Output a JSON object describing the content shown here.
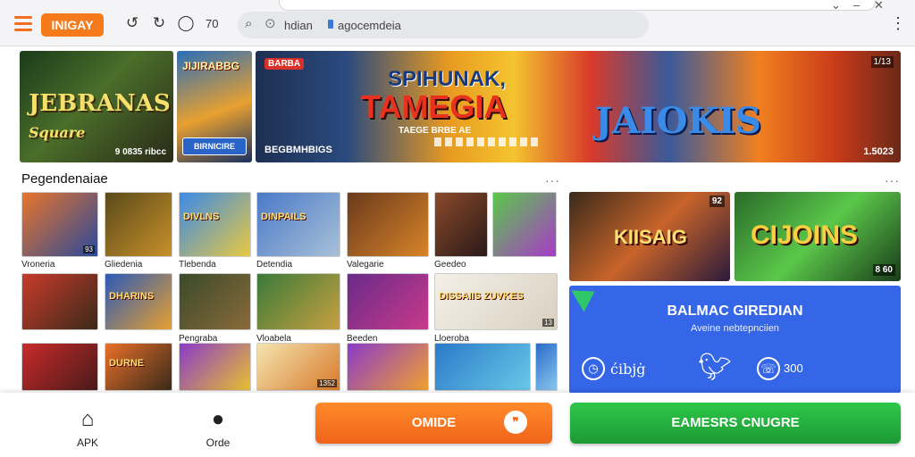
{
  "browser": {
    "logo": "INIGAY",
    "nav_count": "70",
    "address_label": "hdian",
    "url": "agocemdeia"
  },
  "banners": {
    "b1": {
      "title_line1": "JEBRANAS",
      "title_line2": "Square",
      "caption": "9 0835 ribcc"
    },
    "b2": {
      "title": "JIJIRABBG",
      "button": "BIRNICIRE"
    },
    "b3": {
      "tag": "BARBA",
      "left_caption": "BEGBMHBIGS",
      "line1": "SPIHUNAK,",
      "line2": "TAMEGIA",
      "subtitle": "TAEGE BRBE AE",
      "logo_right": "JAIOKIS",
      "page_badge": "1/13",
      "right_caption": "1.5023"
    }
  },
  "section": {
    "title": "Pegendenaiae",
    "more": "···"
  },
  "tiles": [
    {
      "label": "Vroneria",
      "badge": "93",
      "name": "",
      "colors": [
        "#e8742a",
        "#2a4a9a"
      ]
    },
    {
      "label": "Gliedenia",
      "badge": "",
      "name": "",
      "colors": [
        "#5a4a1a",
        "#c8902a"
      ]
    },
    {
      "label": "Tlebenda",
      "badge": "",
      "name": "DIVLNS",
      "colors": [
        "#3a8ae8",
        "#e8c840"
      ]
    },
    {
      "label": "Detendia",
      "badge": "",
      "name": "DINPAILS",
      "colors": [
        "#4a7ac8",
        "#a8c0d8"
      ]
    },
    {
      "label": "Valegarie",
      "badge": "",
      "name": "",
      "colors": [
        "#6a3a1a",
        "#d8842a"
      ]
    },
    {
      "label": "Geedeo",
      "badge": "",
      "name": "",
      "colors": [
        "#8a4a2a",
        "#2a1a1a"
      ]
    },
    {
      "label": "",
      "badge": "",
      "name": "",
      "colors": [
        "#5ac84a",
        "#a83ac8"
      ]
    },
    {
      "label": "",
      "badge": "",
      "name": "",
      "colors": [
        "#c83a2a",
        "#3a2a1a"
      ]
    },
    {
      "label": "",
      "badge": "",
      "name": "DHARINS",
      "colors": [
        "#2a5ab8",
        "#e8a030"
      ]
    },
    {
      "label": "Pengraba",
      "badge": "",
      "name": "",
      "colors": [
        "#3a4a2a",
        "#8a6a3a"
      ]
    },
    {
      "label": "Vloabela",
      "badge": "",
      "name": "",
      "colors": [
        "#3a7a3a",
        "#c8a040"
      ]
    },
    {
      "label": "Beeden",
      "badge": "",
      "name": "",
      "colors": [
        "#6a2a8a",
        "#c83a8a"
      ]
    },
    {
      "label": "Lloeroba",
      "badge": "13",
      "name": "DISSAIIS ZUVKES",
      "colors": [
        "#f4f0e8",
        "#d8d0c0"
      ]
    },
    {
      "label": "",
      "badge": "",
      "name": "",
      "colors": [
        "#c82a2a",
        "#4a1a1a"
      ]
    },
    {
      "label": "",
      "badge": "",
      "name": "DURNE",
      "colors": [
        "#e8702a",
        "#3a2a1a"
      ]
    },
    {
      "label": "",
      "badge": "",
      "name": "",
      "colors": [
        "#8a3ac8",
        "#e8c030"
      ]
    },
    {
      "label": "",
      "badge": "1352",
      "name": "",
      "colors": [
        "#f4e4b0",
        "#d87a2a"
      ]
    },
    {
      "label": "",
      "badge": "",
      "name": "",
      "colors": [
        "#8a3ac8",
        "#f0a030"
      ]
    },
    {
      "label": "",
      "badge": "",
      "name": "",
      "colors": [
        "#2a7ac8",
        "#6ac8e8"
      ]
    },
    {
      "label": "",
      "badge": "",
      "name": "",
      "colors": [
        "#2a6ac8",
        "#8ac8f0"
      ]
    },
    {
      "label": "",
      "badge": "",
      "name": "",
      "colors": [
        "#c83a2a",
        "#2a1a1a"
      ]
    }
  ],
  "right_section": {
    "more": "···"
  },
  "cards": [
    {
      "name": "KIISAIG",
      "badge": "92"
    },
    {
      "name": "CIJOINS",
      "badge": "8 60"
    }
  ],
  "panel": {
    "title": "BALMAC GIREDIAN",
    "subtitle": "Aveine nebtepnciien",
    "ring_text": "ćibjġ",
    "phone_text": "300"
  },
  "bottom": {
    "nav1_label": "APK",
    "nav2_label": "Orde",
    "btn_orange": "OMIDE",
    "btn_green": "EAMESRS CNUGRE"
  },
  "colors": {
    "accent_orange": "#f47a1c",
    "accent_green": "#1c9a34",
    "panel_blue": "#3566e8"
  }
}
